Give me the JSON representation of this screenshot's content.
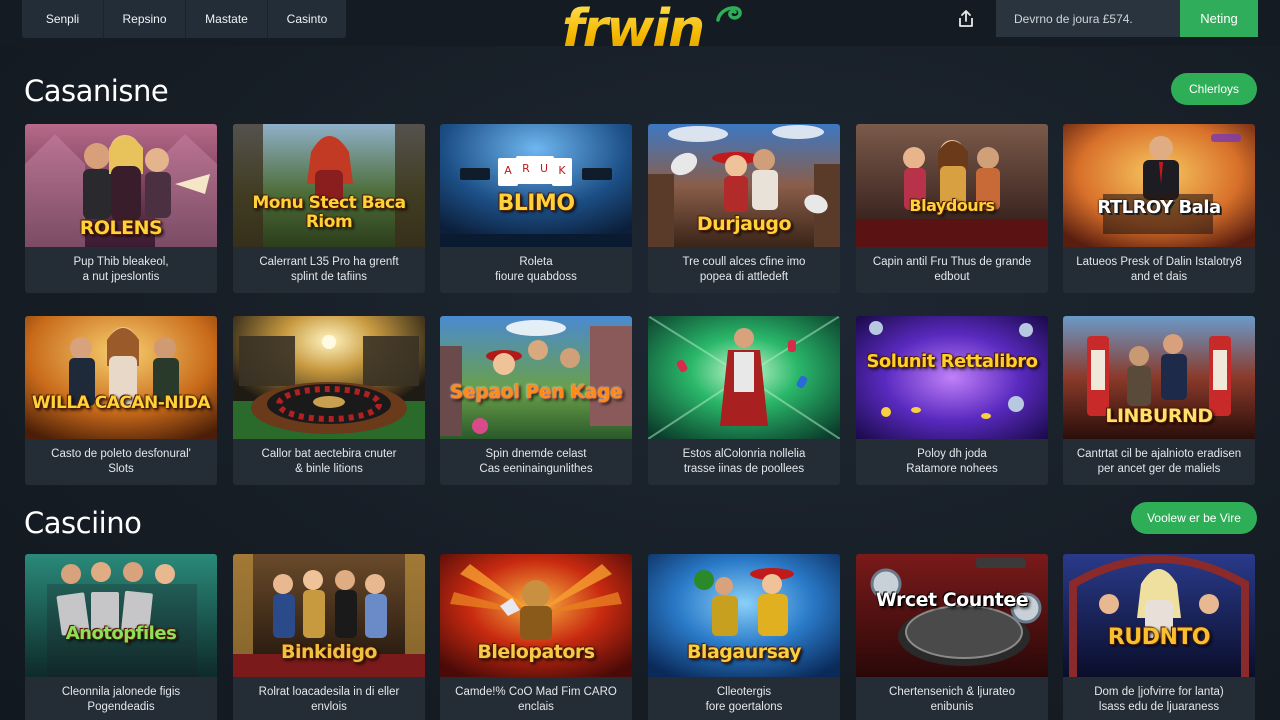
{
  "header": {
    "nav": [
      "Senpli",
      "Repsino",
      "Mastate",
      "Casinto"
    ],
    "logo": "frwin",
    "search_value": "Devrno de joura £574.",
    "signup_label": "Neting"
  },
  "sections": [
    {
      "title": "Casanisne",
      "button": "Chlerloys",
      "rows": [
        [
          {
            "thumb": "ROLENS",
            "line1": "Pup Thib bleakeol,",
            "line2": "a nut jpeslontis"
          },
          {
            "thumb": "Monu Stect Baca Riom",
            "line1": "Calerrant L35 Pro ha grenft",
            "line2": "splint de tafiins"
          },
          {
            "thumb": "BLIMO",
            "line1": "Roleta",
            "line2": "fioure quabdoss"
          },
          {
            "thumb": "Durjaugo",
            "line1": "Tre coull alces cfine imo",
            "line2": "popea di attledeft"
          },
          {
            "thumb": "Blaydours",
            "line1": "Capin antil Fru Thus de grande",
            "line2": "edbout"
          },
          {
            "thumb": "RTLROY Bala",
            "line1": "Latueos Presk of Dalin Istalotry8",
            "line2": "and et dais"
          }
        ],
        [
          {
            "thumb": "WILLA CACAN-NIDA",
            "line1": "Casto de poleto desfonural'",
            "line2": "Slots"
          },
          {
            "thumb": "",
            "line1": "Callor bat aectebira cnuter",
            "line2": "& binle litions"
          },
          {
            "thumb": "Sepaol Pen Kage",
            "line1": "Spin dnemde celast",
            "line2": "Cas eeninaingunlithes"
          },
          {
            "thumb": "",
            "line1": "Estos alColonria nollelia",
            "line2": "trasse iinas de poollees"
          },
          {
            "thumb": "Solunit Rettalibro",
            "line1": "Poloy dh joda",
            "line2": "Ratamore nohees"
          },
          {
            "thumb": "LINBURND",
            "line1": "Cantrtat cil be ajalnioto eradisen",
            "line2": "per ancet ger de maliels"
          }
        ]
      ]
    },
    {
      "title": "Casciino",
      "button": "Voolew er be Vire",
      "rows": [
        [
          {
            "thumb": "Anotopfiles",
            "line1": "Cleonnila jalonede figis",
            "line2": "Pogendeadis"
          },
          {
            "thumb": "Binkidigo",
            "line1": "Rolrat loacadesila in di eller",
            "line2": "envlois"
          },
          {
            "thumb": "Blelopators",
            "line1": "Camde!% CoO Mad Fim CARO",
            "line2": "enclais"
          },
          {
            "thumb": "Blagaursay",
            "line1": "Clleotergis",
            "line2": "fore goertalons"
          },
          {
            "thumb": "Wrcet Countee",
            "line1": "Chertensenich & ljurateo",
            "line2": "enibunis"
          },
          {
            "thumb": "RUDNTO",
            "line1": "Dom de |jofvirre for lanta)",
            "line2": "lsass edu de ljuaraness"
          }
        ]
      ]
    }
  ],
  "colors": {
    "accent": "#2fae58",
    "brand": "#f7c520",
    "card": "#242c35"
  }
}
